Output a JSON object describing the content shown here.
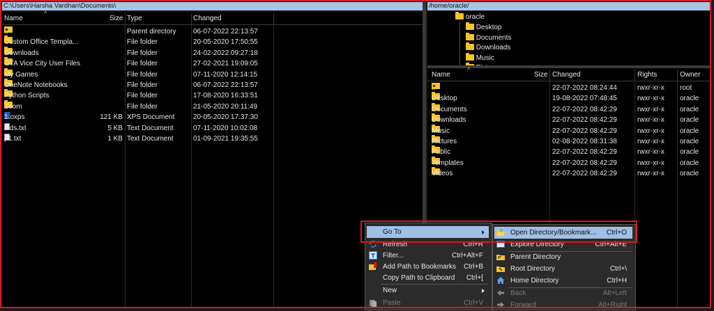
{
  "left": {
    "path": "C:\\Users\\Harsha Vardhan\\Documents\\",
    "columns": {
      "name": "Name",
      "size": "Size",
      "type": "Type",
      "changed": "Changed"
    },
    "rows": [
      {
        "name": "..",
        "size": "",
        "type": "Parent directory",
        "changed": "06-07-2022  22:13:57",
        "icon": "parent-folder"
      },
      {
        "name": "Custom Office Templa...",
        "size": "",
        "type": "File folder",
        "changed": "20-05-2020  17:50:55",
        "icon": "folder"
      },
      {
        "name": "Downloads",
        "size": "",
        "type": "File folder",
        "changed": "24-02-2022  09:27:18",
        "icon": "folder"
      },
      {
        "name": "GTA Vice City User Files",
        "size": "",
        "type": "File folder",
        "changed": "27-02-2021  19:09:05",
        "icon": "folder"
      },
      {
        "name": "My Games",
        "size": "",
        "type": "File folder",
        "changed": "07-11-2020  12:14:15",
        "icon": "folder"
      },
      {
        "name": "OneNote Notebooks",
        "size": "",
        "type": "File folder",
        "changed": "06-07-2022  22:13:57",
        "icon": "folder"
      },
      {
        "name": "Python Scripts",
        "size": "",
        "type": "File folder",
        "changed": "17-08-2020  16:33:51",
        "icon": "folder"
      },
      {
        "name": "Zoom",
        "size": "",
        "type": "File folder",
        "changed": "21-05-2020  20:11:49",
        "icon": "folder"
      },
      {
        "name": "1.oxps",
        "size": "121 KB",
        "type": "XPS Document",
        "changed": "20-05-2020  17:37:30",
        "icon": "xps"
      },
      {
        "name": "aids.txt",
        "size": "5 KB",
        "type": "Text Document",
        "changed": "07-11-2020  10:02:08",
        "icon": "txt"
      },
      {
        "name": "p1.txt",
        "size": "1 KB",
        "type": "Text Document",
        "changed": "01-09-2021  19:35:55",
        "icon": "txt"
      }
    ]
  },
  "right": {
    "path": "/home/oracle/",
    "tree": {
      "root": "oracle",
      "children": [
        "Desktop",
        "Documents",
        "Downloads",
        "Music",
        "Pictures"
      ]
    },
    "columns": {
      "name": "Name",
      "size": "Size",
      "changed": "Changed",
      "rights": "Rights",
      "owner": "Owner"
    },
    "rows": [
      {
        "name": "..",
        "size": "",
        "changed": "22-07-2022  08:24:44",
        "rights": "rwxr-xr-x",
        "owner": "root",
        "icon": "parent-folder"
      },
      {
        "name": "Desktop",
        "size": "",
        "changed": "19-08-2022  07:48:45",
        "rights": "rwxr-xr-x",
        "owner": "oracle",
        "icon": "folder"
      },
      {
        "name": "Documents",
        "size": "",
        "changed": "22-07-2022  08:42:29",
        "rights": "rwxr-xr-x",
        "owner": "oracle",
        "icon": "folder"
      },
      {
        "name": "Downloads",
        "size": "",
        "changed": "22-07-2022  08:42:29",
        "rights": "rwxr-xr-x",
        "owner": "oracle",
        "icon": "folder"
      },
      {
        "name": "Music",
        "size": "",
        "changed": "22-07-2022  08:42:29",
        "rights": "rwxr-xr-x",
        "owner": "oracle",
        "icon": "folder"
      },
      {
        "name": "Pictures",
        "size": "",
        "changed": "02-08-2022  08:31:38",
        "rights": "rwxr-xr-x",
        "owner": "oracle",
        "icon": "folder"
      },
      {
        "name": "Public",
        "size": "",
        "changed": "22-07-2022  08:42:29",
        "rights": "rwxr-xr-x",
        "owner": "oracle",
        "icon": "folder"
      },
      {
        "name": "Templates",
        "size": "",
        "changed": "22-07-2022  08:42:29",
        "rights": "rwxr-xr-x",
        "owner": "oracle",
        "icon": "folder"
      },
      {
        "name": "Videos",
        "size": "",
        "changed": "22-07-2022  08:42:29",
        "rights": "rwxr-xr-x",
        "owner": "oracle",
        "icon": "folder"
      }
    ]
  },
  "context_menu": {
    "items": [
      {
        "label": "Go To",
        "shortcut": "",
        "submenu": true,
        "icon": "",
        "highlighted": true
      },
      {
        "label": "Refresh",
        "shortcut": "Ctrl+R",
        "submenu": false,
        "icon": "refresh-icon"
      },
      {
        "label": "Filter...",
        "shortcut": "Ctrl+Alt+F",
        "submenu": false,
        "icon": "filter-icon"
      },
      {
        "label": "Add Path to Bookmarks",
        "shortcut": "Ctrl+B",
        "submenu": false,
        "icon": "bookmark-icon"
      },
      {
        "label": "Copy Path to Clipboard",
        "shortcut": "Ctrl+[",
        "submenu": false,
        "icon": ""
      },
      {
        "label": "New",
        "shortcut": "",
        "submenu": true,
        "icon": ""
      },
      {
        "label": "Paste",
        "shortcut": "Ctrl+V",
        "submenu": false,
        "icon": "paste-icon",
        "disabled": true
      }
    ]
  },
  "submenu": {
    "items": [
      {
        "label": "Open Directory/Bookmark...",
        "shortcut": "Ctrl+O",
        "icon": "open-folder-icon",
        "highlighted": true
      },
      {
        "label": "Explore Directory",
        "shortcut": "Ctrl+Alt+E",
        "icon": "explore-icon"
      },
      {
        "label": "Parent Directory",
        "shortcut": "",
        "icon": "parent-directory-icon"
      },
      {
        "label": "Root Directory",
        "shortcut": "Ctrl+\\",
        "icon": "root-directory-icon"
      },
      {
        "label": "Home Directory",
        "shortcut": "Ctrl+H",
        "icon": "home-icon"
      },
      {
        "label": "Back",
        "shortcut": "Alt+Left",
        "icon": "back-arrow-icon",
        "disabled": true
      },
      {
        "label": "Forward",
        "shortcut": "Alt+Right",
        "icon": "forward-arrow-icon",
        "disabled": true
      }
    ]
  },
  "colors": {
    "highlight": "#9ec0e6",
    "folder": "#f6c22c",
    "annotation_red": "#d71920",
    "path_bar": "#a9c4e4"
  }
}
